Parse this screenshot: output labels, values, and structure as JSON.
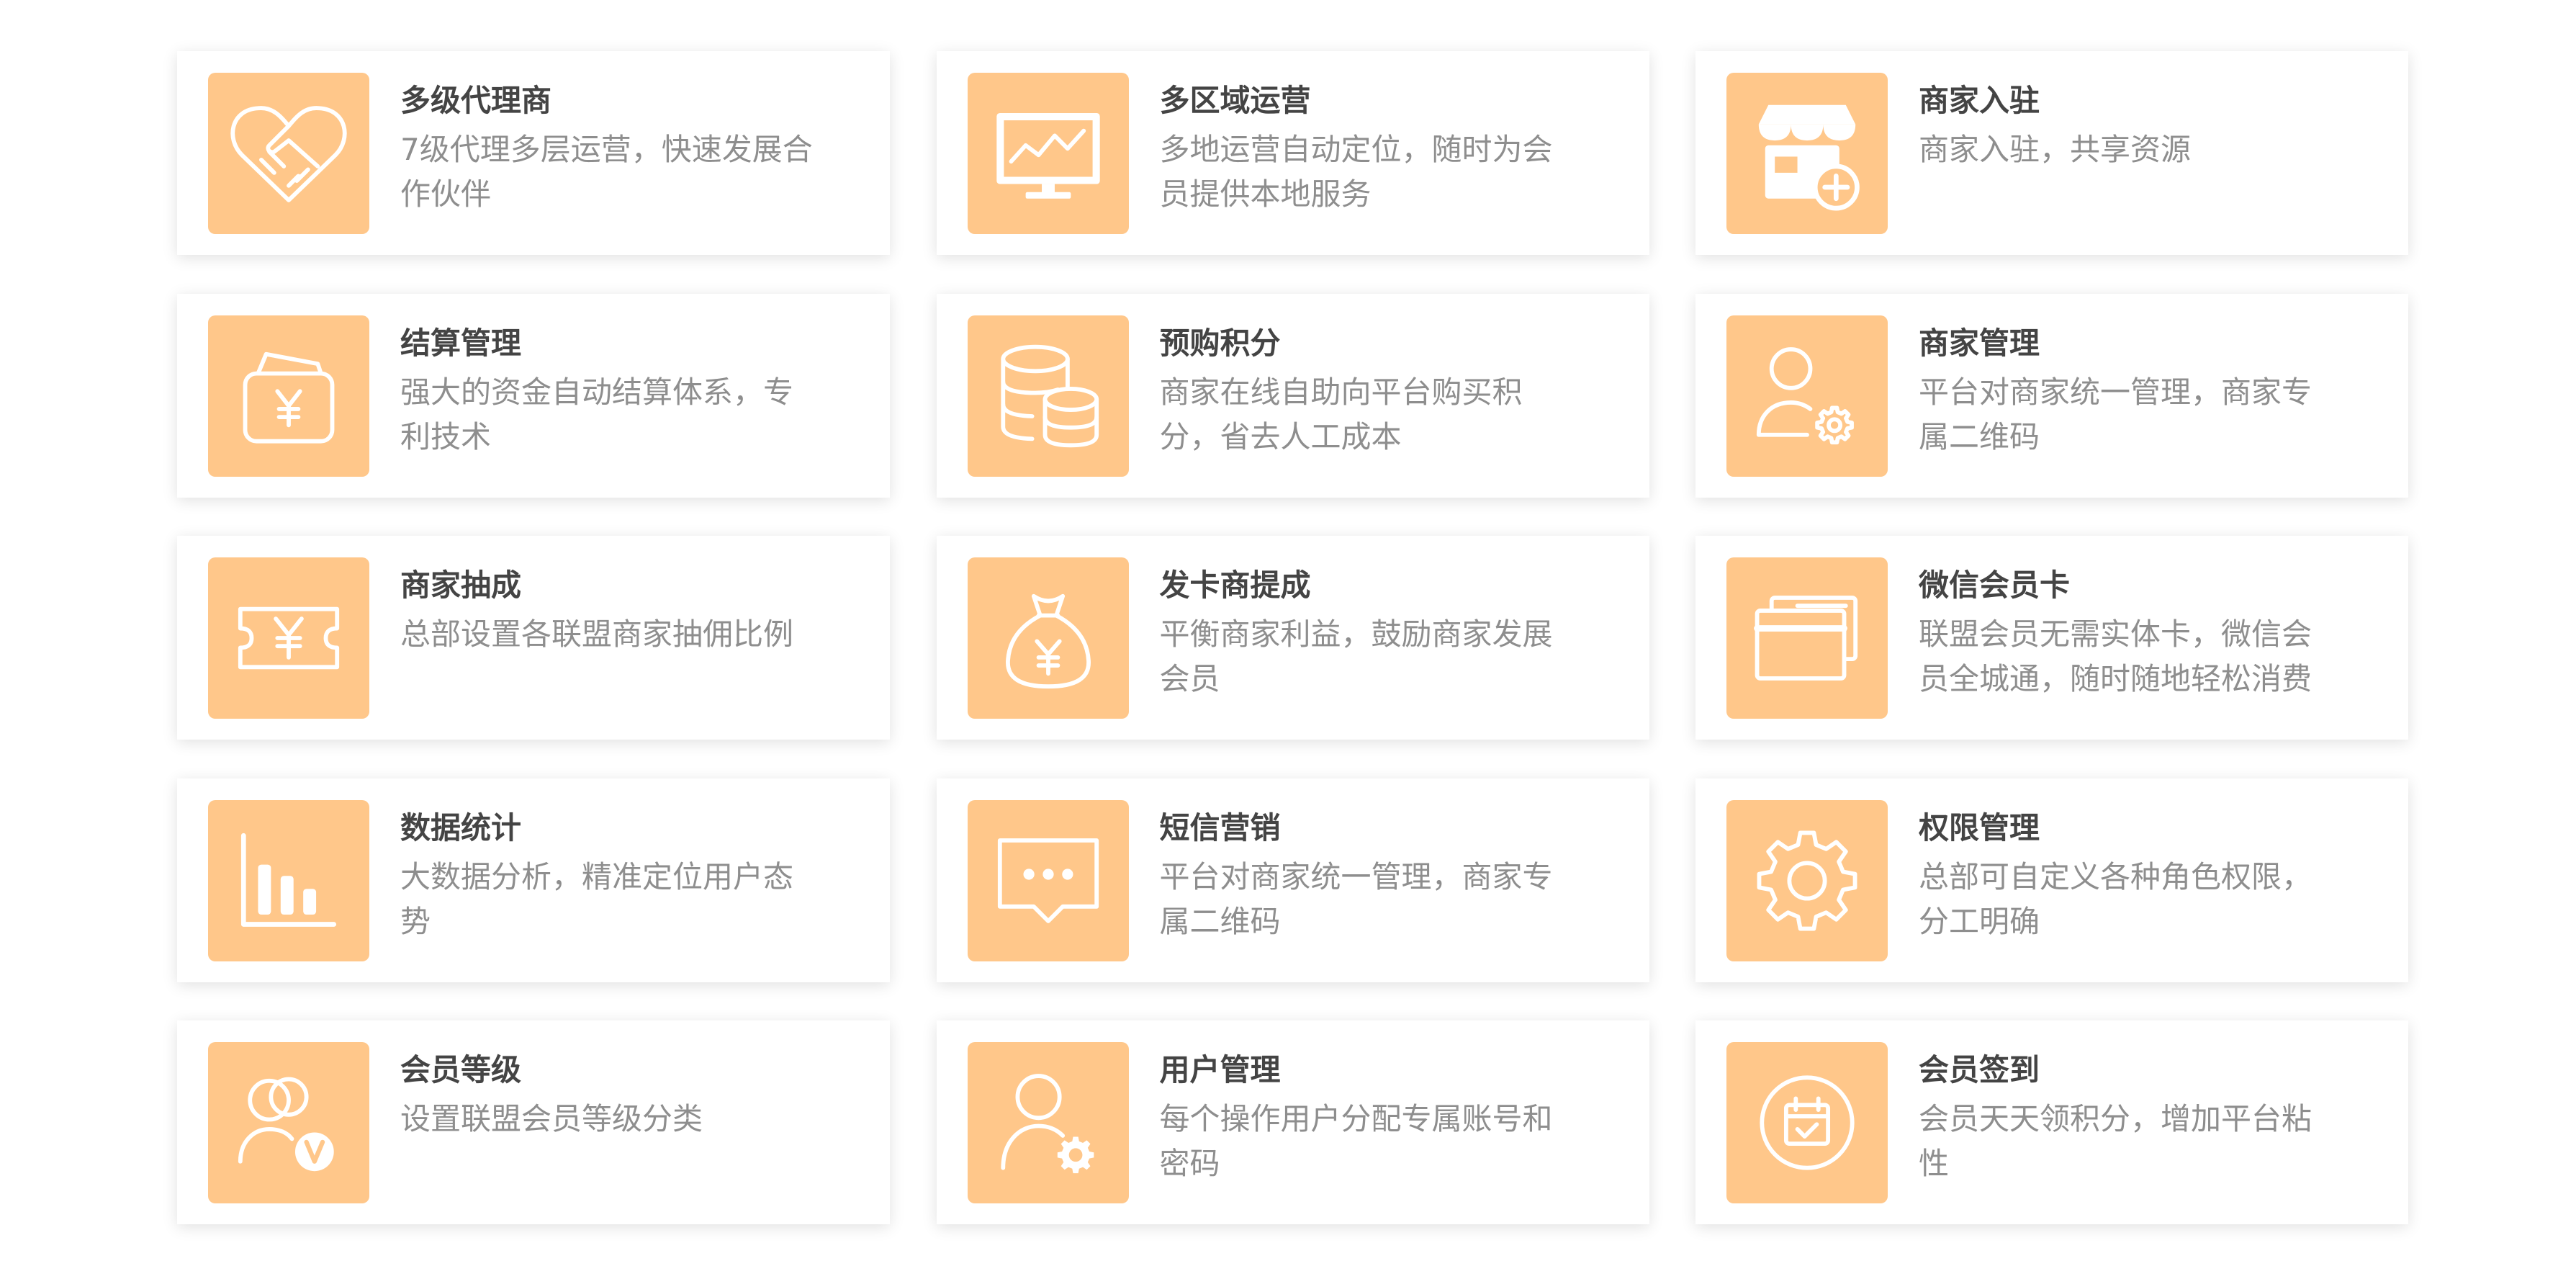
{
  "colors": {
    "icon_background": "#FFC78A",
    "title": "#444444",
    "description": "#8E8E8E",
    "card_background": "#FFFFFF"
  },
  "features": [
    {
      "title": "多级代理商",
      "description": "7级代理多层运营，快速发展合作伙伴",
      "icon": "handshake-heart-icon"
    },
    {
      "title": "多区域运营",
      "description": "多地运营自动定位，随时为会员提供本地服务",
      "icon": "monitor-chart-icon"
    },
    {
      "title": "商家入驻",
      "description": "商家入驻，共享资源",
      "icon": "store-add-icon"
    },
    {
      "title": "结算管理",
      "description": "强大的资金自动结算体系，专利技术",
      "icon": "wallet-yen-icon"
    },
    {
      "title": "预购积分",
      "description": "商家在线自助向平台购买积分，省去人工成本",
      "icon": "database-icon"
    },
    {
      "title": "商家管理",
      "description": "平台对商家统一管理，商家专属二维码",
      "icon": "user-gear-icon"
    },
    {
      "title": "商家抽成",
      "description": "总部设置各联盟商家抽佣比例",
      "icon": "ticket-yen-icon"
    },
    {
      "title": "发卡商提成",
      "description": "平衡商家利益，鼓励商家发展会员",
      "icon": "money-bag-icon"
    },
    {
      "title": "微信会员卡",
      "description": "联盟会员无需实体卡，微信会员全城通，随时随地轻松消费",
      "icon": "member-card-icon"
    },
    {
      "title": "数据统计",
      "description": "大数据分析，精准定位用户态势",
      "icon": "bar-chart-icon"
    },
    {
      "title": "短信营销",
      "description": "平台对商家统一管理，商家专属二维码",
      "icon": "message-icon"
    },
    {
      "title": "权限管理",
      "description": "总部可自定义各种角色权限，分工明确",
      "icon": "gear-icon"
    },
    {
      "title": "会员等级",
      "description": "设置联盟会员等级分类",
      "icon": "vip-users-icon"
    },
    {
      "title": "用户管理",
      "description": "每个操作用户分配专属账号和密码",
      "icon": "user-settings-icon"
    },
    {
      "title": "会员签到",
      "description": "会员天天领积分，增加平台粘性",
      "icon": "calendar-check-icon"
    }
  ]
}
